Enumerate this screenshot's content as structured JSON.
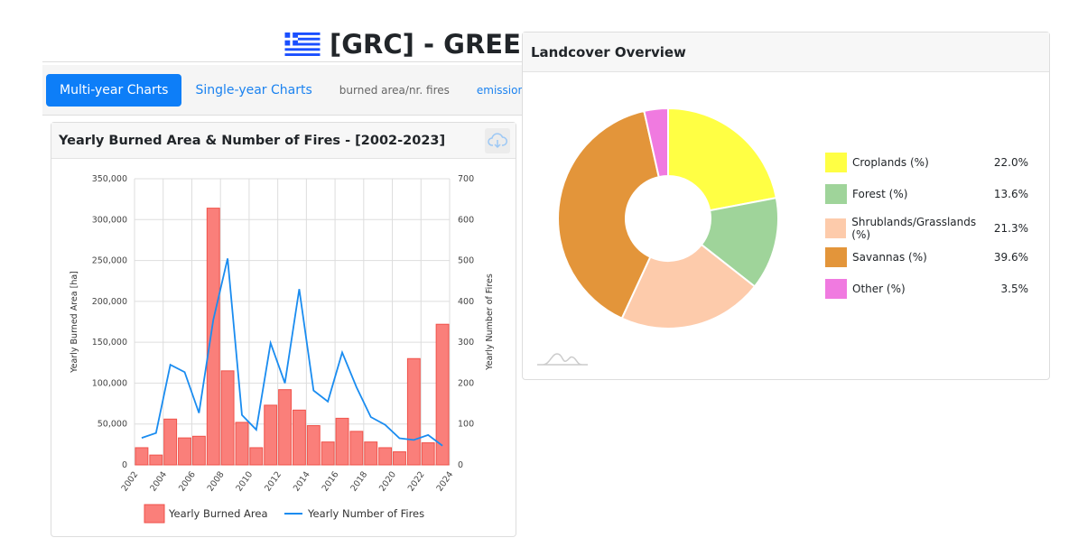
{
  "header": {
    "title": "[GRC] - GREECE",
    "flag": "greece-flag"
  },
  "tabs": [
    {
      "label": "Multi-year Charts",
      "active": true
    },
    {
      "label": "Single-year Charts"
    },
    {
      "label": "burned area/nr. fires"
    },
    {
      "label": "emissions"
    }
  ],
  "chart_card": {
    "title": "Yearly Burned Area & Number of Fires - [2002-2023]",
    "download_icon": "cloud-download-icon"
  },
  "chart_data": {
    "type": "bar+line",
    "title": "Yearly Burned Area & Number of Fires - [2002-2023]",
    "years": [
      2002,
      2003,
      2004,
      2005,
      2006,
      2007,
      2008,
      2009,
      2010,
      2011,
      2012,
      2013,
      2014,
      2015,
      2016,
      2017,
      2018,
      2019,
      2020,
      2021,
      2022,
      2023
    ],
    "x_tick_labels": [
      "2002",
      "2004",
      "2006",
      "2008",
      "2010",
      "2012",
      "2014",
      "2016",
      "2018",
      "2020",
      "2022",
      "2024"
    ],
    "series": [
      {
        "name": "Yearly Burned Area",
        "type": "bar",
        "axis": "left",
        "color": "#fa7f7a",
        "values": [
          21000,
          12000,
          56000,
          33000,
          35000,
          314000,
          115000,
          52000,
          21000,
          73000,
          92000,
          67000,
          48000,
          28000,
          57000,
          41000,
          28000,
          21000,
          16000,
          130000,
          27000,
          172000
        ]
      },
      {
        "name": "Yearly Number of Fires",
        "type": "line",
        "axis": "right",
        "color": "#1a8cf0",
        "values": [
          66,
          78,
          245,
          227,
          127,
          355,
          505,
          122,
          86,
          298,
          200,
          430,
          182,
          155,
          275,
          190,
          117,
          98,
          65,
          61,
          73,
          47
        ]
      }
    ],
    "ylabel": "Yearly Burned Area [ha]",
    "y2label": "Yearly Number of Fires",
    "ylim": [
      0,
      350000
    ],
    "y2lim": [
      0,
      700
    ],
    "y_tick_labels": [
      "0",
      "50,000",
      "100,000",
      "150,000",
      "200,000",
      "250,000",
      "300,000",
      "350,000"
    ],
    "y2_tick_labels": [
      "0",
      "100",
      "200",
      "300",
      "400",
      "500",
      "600",
      "700"
    ],
    "legend": "bottom",
    "grid": true
  },
  "landcover": {
    "title": "Landcover Overview",
    "chart_data": {
      "type": "pie",
      "donut": true,
      "slices": [
        {
          "label": "Croplands (%)",
          "value": 22.0,
          "display": "22.0%",
          "color": "#ffff44"
        },
        {
          "label": "Forest (%)",
          "value": 13.6,
          "display": "13.6%",
          "color": "#9fd49a"
        },
        {
          "label": "Shrublands/Grasslands (%)",
          "value": 21.3,
          "display": "21.3%",
          "color": "#fdcbab"
        },
        {
          "label": "Savannas (%)",
          "value": 39.6,
          "display": "39.6%",
          "color": "#e3953a"
        },
        {
          "label": "Other (%)",
          "value": 3.5,
          "display": "3.5%",
          "color": "#f07ae0"
        }
      ]
    }
  }
}
